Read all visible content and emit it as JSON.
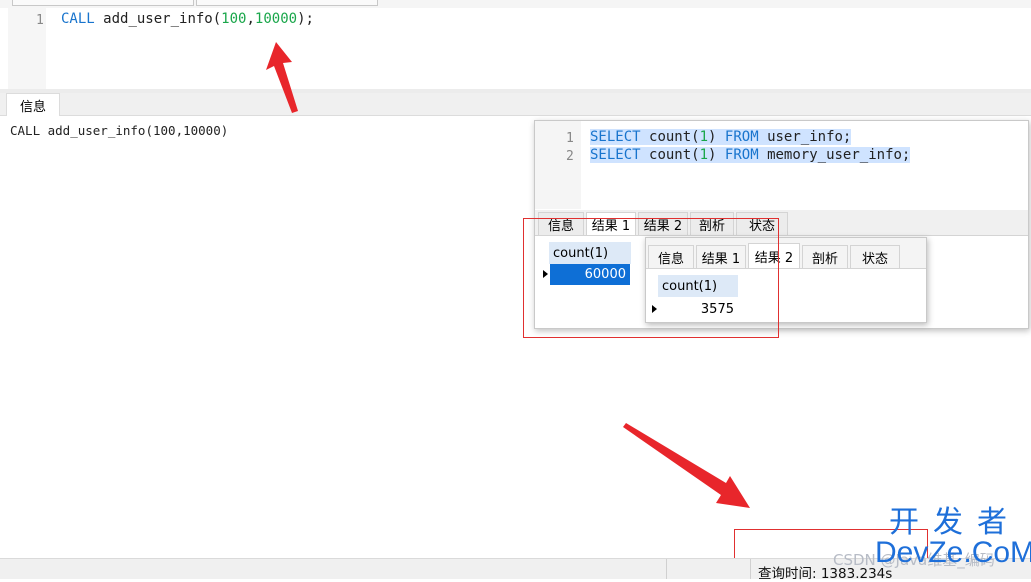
{
  "editor": {
    "line_number": "1",
    "code": {
      "keyword": "CALL",
      "func": "add_user_info(",
      "arg1": "100",
      "comma": ",",
      "arg2": "10000",
      "end": ");"
    }
  },
  "message_panel": {
    "tab_label": "信息",
    "text": "CALL add_user_info(100,10000)"
  },
  "overlay_query": {
    "lines": [
      {
        "number": "1",
        "kw1": "SELECT",
        "fn": "count(",
        "arg": "1",
        "close": ")",
        "kw2": "FROM",
        "table": "user_info;"
      },
      {
        "number": "2",
        "kw1": "SELECT",
        "fn": "count(",
        "arg": "1",
        "close": ")",
        "kw2": "FROM",
        "table": "memory_user_info;"
      }
    ],
    "tabs": [
      "信息",
      "结果 1",
      "结果 2",
      "剖析",
      "状态"
    ],
    "active_tab": "结果 1",
    "result": {
      "column": "count(1)",
      "value": "60000"
    }
  },
  "overlay_result2": {
    "tabs": [
      "信息",
      "结果 1",
      "结果 2",
      "剖析",
      "状态"
    ],
    "active_tab": "结果 2",
    "result": {
      "column": "count(1)",
      "value": "3575"
    }
  },
  "status_bar": {
    "query_time": "查询时间: 1383.234s"
  },
  "watermark": {
    "csdn": "CSDN @Java维基_编码",
    "site_cn": "开发者",
    "site_en": "DevZe.CoM"
  },
  "colors": {
    "keyword": "#1874cd",
    "number": "#19a64a",
    "selection": "#cfe3ff",
    "active_cell": "#0e6fd6",
    "annotation_red": "#e03030"
  }
}
